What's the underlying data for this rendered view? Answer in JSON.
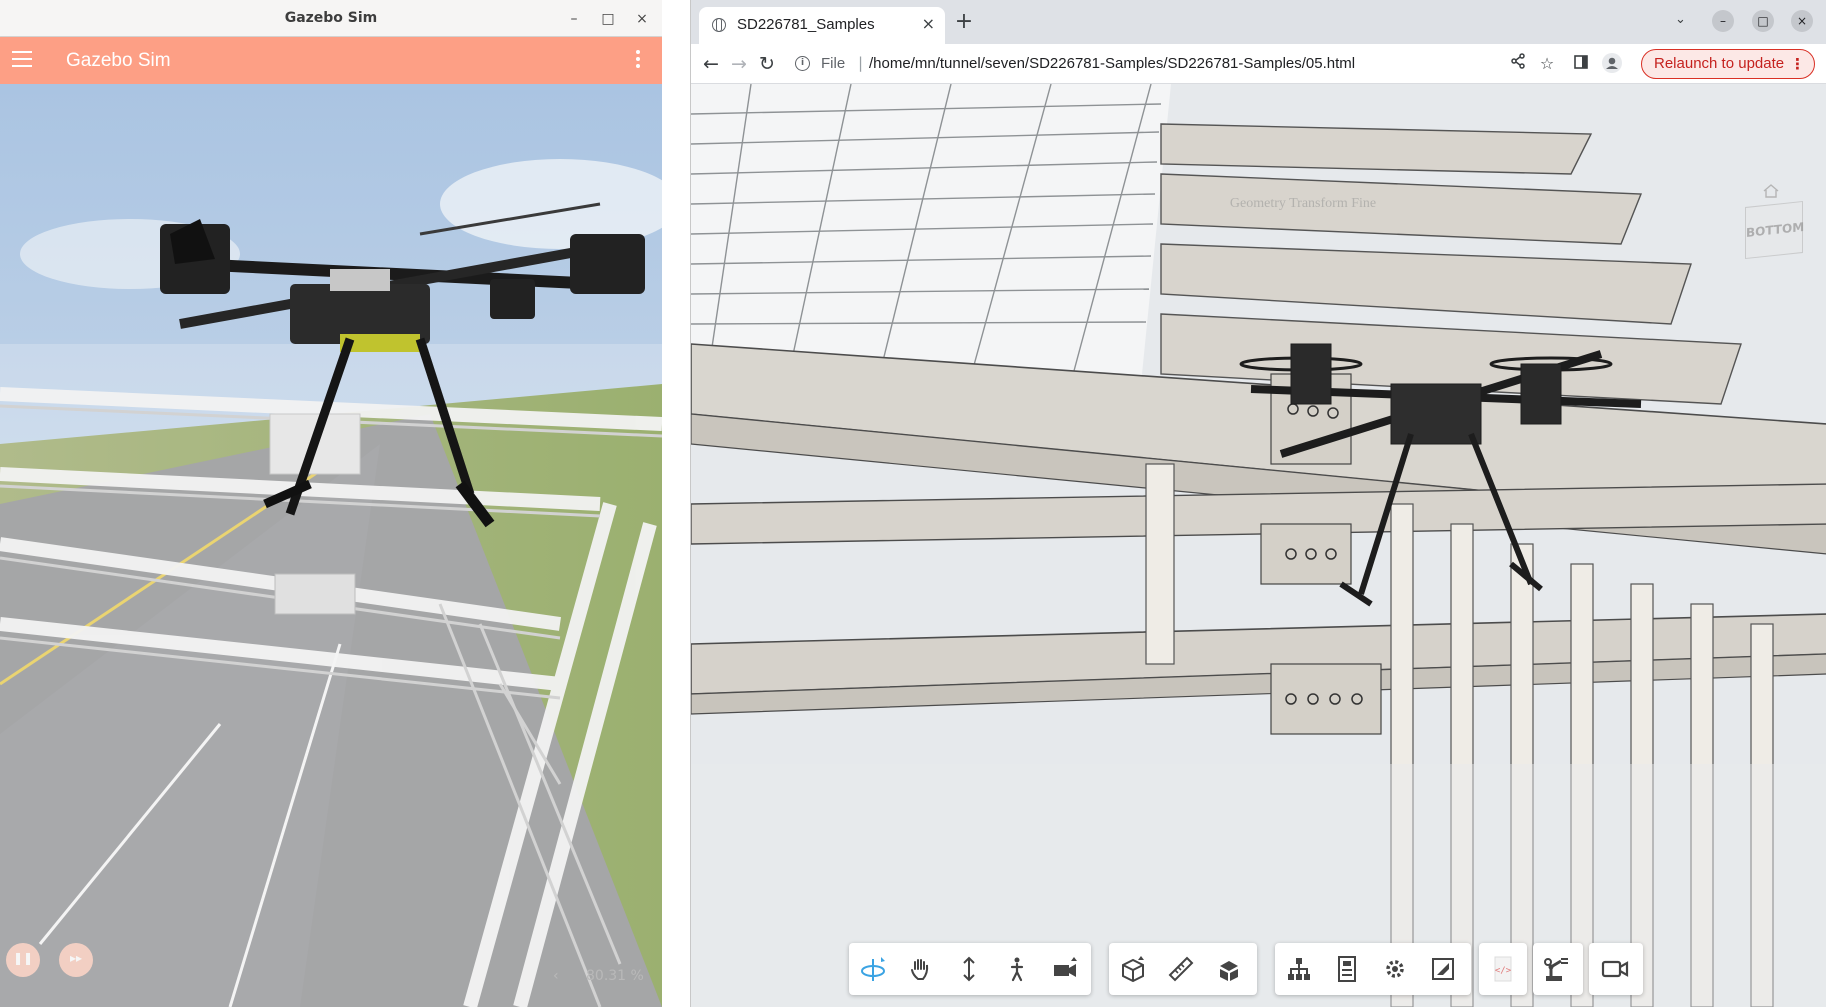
{
  "gazebo": {
    "window_title": "Gazebo Sim",
    "app_title": "Gazebo Sim",
    "rtf_value": "80.31 %",
    "controls": {
      "play_icon": "pause-icon",
      "step_icon": "step-icon",
      "rtf_arrow": "‹"
    },
    "window_buttons": {
      "minimize": "–",
      "maximize": "□",
      "close": "×"
    },
    "colors": {
      "appbar": "#fd9f85",
      "sky": "#c8d9ec",
      "grass": "#8fa55c",
      "road": "#8f8f92"
    }
  },
  "browser": {
    "tab_title": "SD226781_Samples",
    "tab_close": "×",
    "new_tab": "+",
    "tab_search": "⌄",
    "window_buttons": {
      "minimize": "–",
      "maximize": "□",
      "close": "×"
    },
    "nav": {
      "back": "←",
      "forward": "→",
      "reload": "↻"
    },
    "omnibox": {
      "info": "i",
      "scheme": "File",
      "separator": "|",
      "url": "/home/mn/tunnel/seven/SD226781-Samples/SD226781-Samples/05.html"
    },
    "relaunch_label": "Relaunch to update",
    "relaunch_menu": "⋮",
    "colors": {
      "relaunch_border": "#d93025",
      "relaunch_text": "#c5221f",
      "tab_strip": "#dee1e6"
    }
  },
  "viewer": {
    "overlay_label": "Geometry Transform Fine",
    "viewcube_face": "BOTTOM",
    "toolbar_icons": [
      "orbit-icon",
      "pan-icon",
      "zoom-icon",
      "first-person-icon",
      "camera-icon",
      "section-box-icon",
      "measure-icon",
      "explode-icon",
      "model-browser-icon",
      "properties-icon",
      "settings-icon",
      "fullscreen-icon",
      "code-icon",
      "robot-arm-icon",
      "video-camera-icon"
    ]
  }
}
